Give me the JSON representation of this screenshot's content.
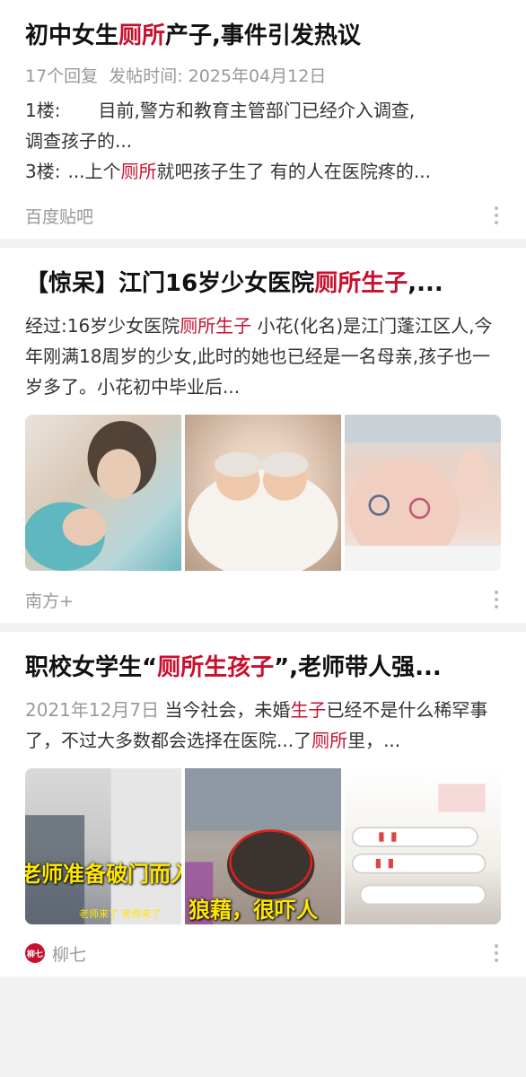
{
  "results": [
    {
      "title_parts": [
        "初中女生",
        "厕所",
        "产子,事件引发热议"
      ],
      "meta": {
        "replies": "17个回复",
        "post_time": "发帖时间: 2025年04月12日"
      },
      "floor1": {
        "label": "1楼:",
        "text1": "目前,警方和教育主管部门已经介入调查,",
        "text2": "调查孩子的..."
      },
      "floor3": {
        "label": "3楼:",
        "text_a": "...上个",
        "hl": "厕所",
        "text_b": "就吧孩子生了 有的人在医院疼的..."
      },
      "source": "百度贴吧"
    },
    {
      "title_parts": [
        "【惊呆】江门16岁少女医院",
        "厕所生子",
        ",..."
      ],
      "body_a": "经过:16岁少女医院",
      "body_hl": "厕所生子",
      "body_b": " 小花(化名)是江门蓬江区人,今年刚满18周岁的少女,此时的她也已经是一名母亲,孩子也一岁多了。小花初中毕业后...",
      "source": "南方+"
    },
    {
      "title_parts": [
        "职校女学生“",
        "厕所生孩子",
        "”,老师带人强..."
      ],
      "date": "2021年12月7日",
      "body_a": "  当今社会，未婚",
      "body_hl1": "生子",
      "body_b": "已经不是什么稀罕事了，不过大多数都会选择在医院...了",
      "body_hl2": "厕所",
      "body_c": "里，...",
      "overlay1": "老师准备破门而入",
      "overlay1_small": "老师来了 老师来了",
      "overlay2": "狼藉，很吓人",
      "source": "柳七",
      "source_logo": "柳七"
    }
  ]
}
